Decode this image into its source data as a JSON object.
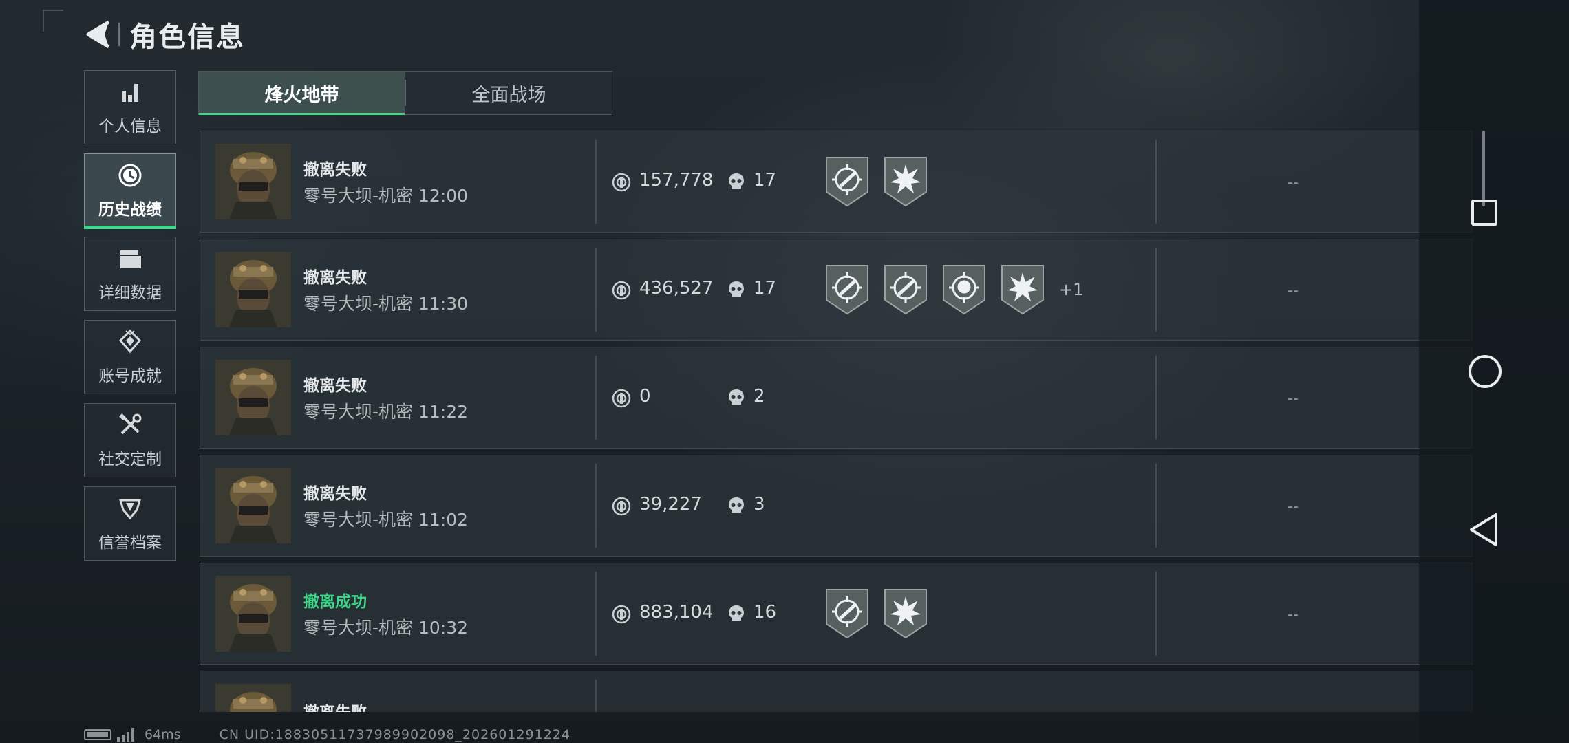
{
  "header": {
    "title": "角色信息"
  },
  "sidebar": {
    "items": [
      {
        "label": "个人信息",
        "icon": "bar-chart-icon",
        "active": false
      },
      {
        "label": "历史战绩",
        "icon": "clock-icon",
        "active": true
      },
      {
        "label": "详细数据",
        "icon": "folder-icon",
        "active": false
      },
      {
        "label": "账号成就",
        "icon": "achievement-icon",
        "active": false
      },
      {
        "label": "社交定制",
        "icon": "tools-icon",
        "active": false
      },
      {
        "label": "信誉档案",
        "icon": "reputation-icon",
        "active": false
      }
    ]
  },
  "tabs": [
    {
      "label": "烽火地带",
      "active": true
    },
    {
      "label": "全面战场",
      "active": false
    }
  ],
  "records": [
    {
      "status": "撤离失败",
      "success": false,
      "map": "零号大坝-机密",
      "time": "12:00",
      "value": "157,778",
      "kills": "17",
      "badges": [
        "target-badge-icon",
        "explosion-badge-icon"
      ],
      "extra": "",
      "result": "--"
    },
    {
      "status": "撤离失败",
      "success": false,
      "map": "零号大坝-机密",
      "time": "11:30",
      "value": "436,527",
      "kills": "17",
      "badges": [
        "target-badge-icon",
        "target-badge-icon",
        "skull-target-badge-icon",
        "explosion-badge-icon"
      ],
      "extra": "+1",
      "result": "--"
    },
    {
      "status": "撤离失败",
      "success": false,
      "map": "零号大坝-机密",
      "time": "11:22",
      "value": "0",
      "kills": "2",
      "badges": [],
      "extra": "",
      "result": "--"
    },
    {
      "status": "撤离失败",
      "success": false,
      "map": "零号大坝-机密",
      "time": "11:02",
      "value": "39,227",
      "kills": "3",
      "badges": [],
      "extra": "",
      "result": "--"
    },
    {
      "status": "撤离成功",
      "success": true,
      "map": "零号大坝-机密",
      "time": "10:32",
      "value": "883,104",
      "kills": "16",
      "badges": [
        "target-badge-icon",
        "explosion-badge-icon"
      ],
      "extra": "",
      "result": "--"
    },
    {
      "status": "撤离失败",
      "success": false,
      "map": "",
      "time": "",
      "value": "",
      "kills": "",
      "badges": [],
      "extra": "",
      "result": ""
    }
  ],
  "footer": {
    "ping": "64ms",
    "uid": "CN UID:18830511737989902098_202601291224"
  },
  "colors": {
    "accent": "#3fd58a",
    "success": "#3fd58a",
    "panel": "#2c363c"
  }
}
